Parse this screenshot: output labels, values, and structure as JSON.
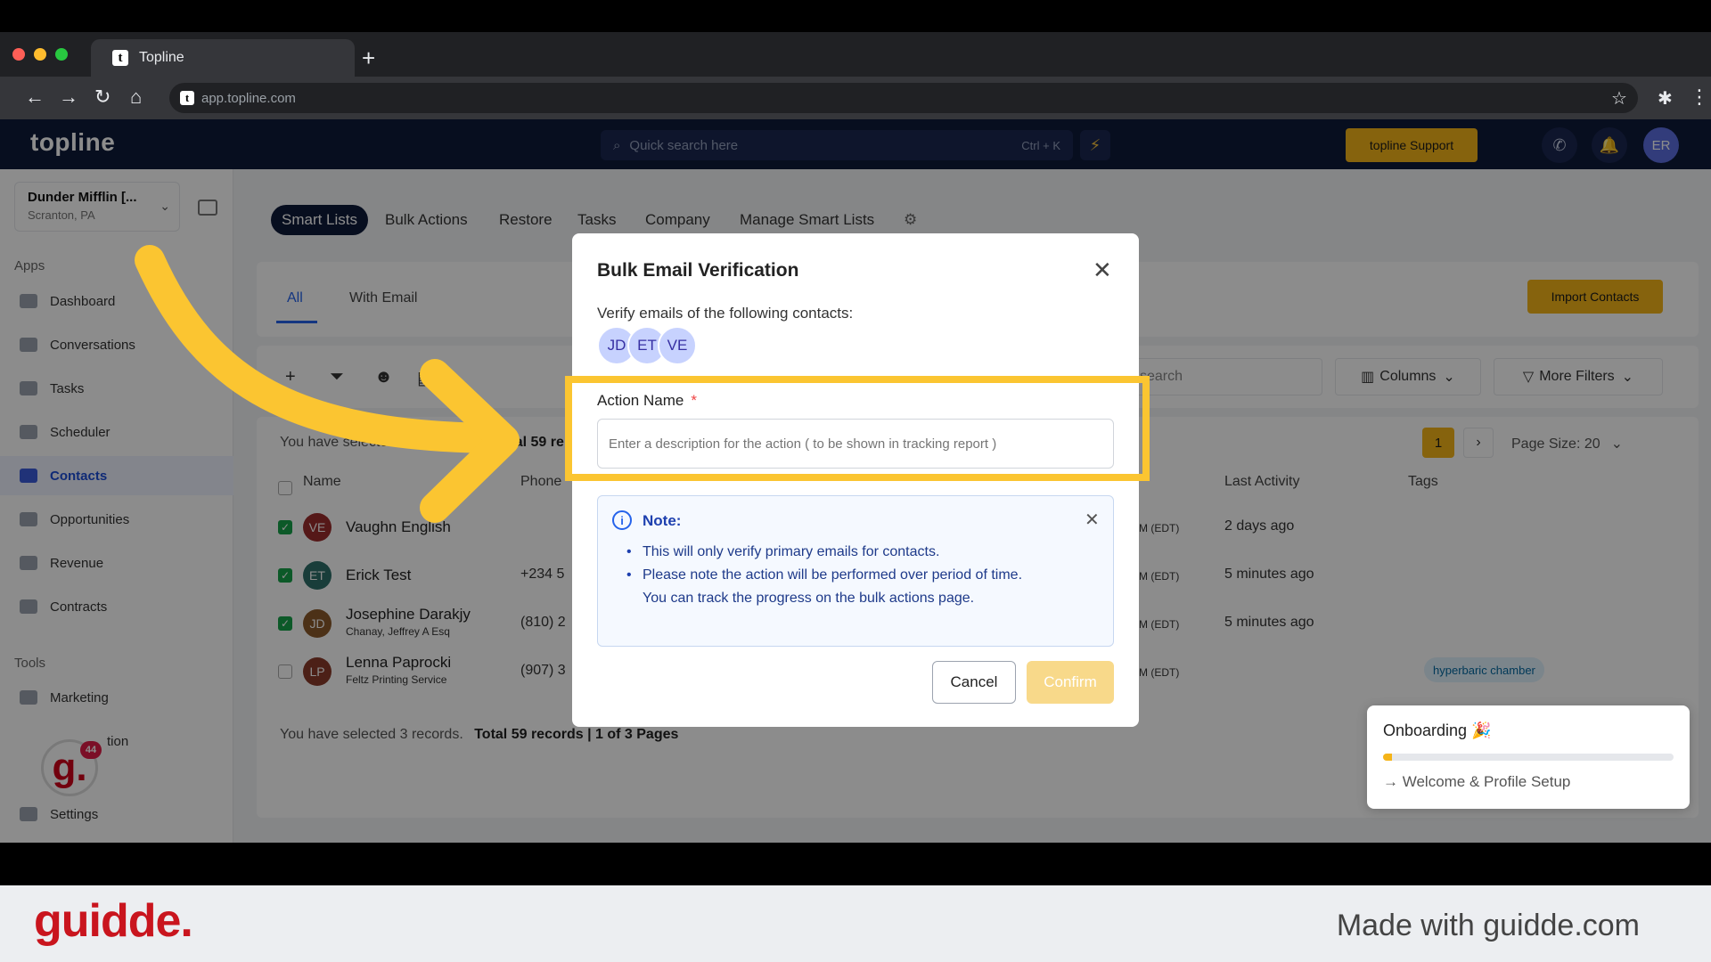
{
  "browser": {
    "tab_title": "Topline",
    "tab_favicon": "t",
    "url": "app.topline.com",
    "new_tab": "+"
  },
  "app": {
    "logo": "topline",
    "search_placeholder": "Quick search here",
    "search_shortcut": "Ctrl + K",
    "support_label": "topline Support",
    "user_initials": "ER"
  },
  "sidebar": {
    "location_name": "Dunder Mifflin [...",
    "location_city": "Scranton, PA",
    "apps_label": "Apps",
    "tools_label": "Tools",
    "items": [
      {
        "label": "Dashboard"
      },
      {
        "label": "Conversations"
      },
      {
        "label": "Tasks"
      },
      {
        "label": "Scheduler"
      },
      {
        "label": "Contacts"
      },
      {
        "label": "Opportunities"
      },
      {
        "label": "Revenue"
      },
      {
        "label": "Contracts"
      }
    ],
    "tool_items": [
      {
        "label": "Marketing"
      },
      {
        "label": "tion"
      },
      {
        "label": "Settings"
      }
    ],
    "guidde_badge_letter": "g.",
    "guidde_badge_count": "44"
  },
  "main": {
    "tabs": [
      "Smart Lists",
      "Bulk Actions",
      "Restore",
      "Tasks",
      "Company",
      "Manage Smart Lists"
    ],
    "subtabs": [
      "All",
      "With Email"
    ],
    "import_label": "Import Contacts",
    "search_placeholder": "search",
    "columns_label": "Columns",
    "filters_label": "More Filters",
    "selected_prefix": "You have selected 3 re",
    "total_partial": "Total 59 re",
    "page_current": "1",
    "page_size": "Page Size: 20",
    "headers": {
      "name": "Name",
      "phone": "Phone",
      "last_activity": "Last Activity",
      "tags": "Tags"
    },
    "rows": [
      {
        "initials": "VE",
        "name": "Vaughn English",
        "sub": "",
        "phone": "",
        "time": "M (EDT)",
        "activity": "2 days ago",
        "color": "#9b2c2c"
      },
      {
        "initials": "ET",
        "name": "Erick Test",
        "sub": "",
        "phone": "+234 5",
        "time": "M (EDT)",
        "activity": "5 minutes ago",
        "color": "#2f6f6a"
      },
      {
        "initials": "JD",
        "name": "Josephine Darakjy",
        "sub": "Chanay, Jeffrey A Esq",
        "phone": "(810) 2",
        "time": "M (EDT)",
        "activity": "5 minutes ago",
        "color": "#8a5a2b"
      },
      {
        "initials": "LP",
        "name": "Lenna Paprocki",
        "sub": "Feltz Printing Service",
        "phone": "(907) 3",
        "time": "M (EDT)",
        "activity": "",
        "color": "#8a3b2b"
      }
    ],
    "tag_label": "hyperbaric chamber",
    "footer_selected": "You have selected 3 records.",
    "footer_total": "Total 59 records",
    "footer_pages": "1 of 3 Pages"
  },
  "modal": {
    "title": "Bulk Email Verification",
    "subtitle": "Verify emails of the following contacts:",
    "contacts": [
      "JD",
      "ET",
      "VE"
    ],
    "field_label": "Action Name",
    "required_mark": "*",
    "field_placeholder": "Enter a description for the action ( to be shown in tracking report )",
    "note_title": "Note:",
    "note_points": [
      "This will only verify primary emails for contacts.",
      "Please note the action will be performed over period of time. You can track the progress on the bulk actions page."
    ],
    "cancel_label": "Cancel",
    "confirm_label": "Confirm"
  },
  "onboarding": {
    "title": "Onboarding 🎉",
    "step": "→ Welcome & Profile Setup",
    "progress": 0.03
  },
  "footer": {
    "brand": "guidde.",
    "made_with": "Made with guidde.com"
  },
  "colors": {
    "accent": "#f5b418",
    "highlight": "#fbc531",
    "nav": "#0e1a3a"
  }
}
